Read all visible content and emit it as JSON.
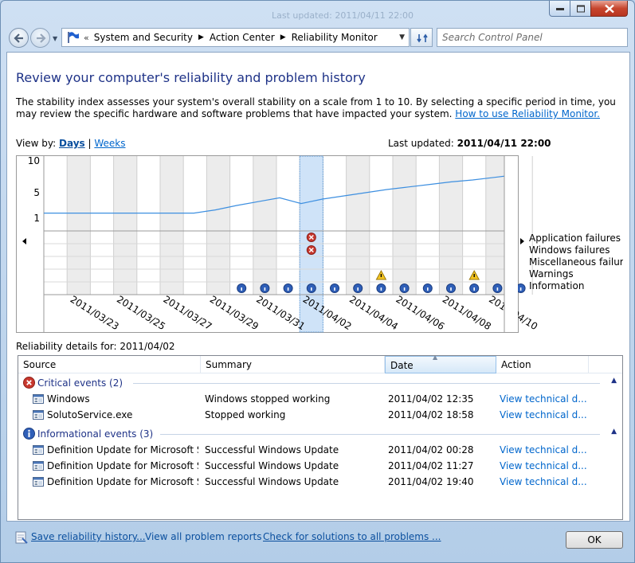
{
  "window": {
    "ghost_title": "Last updated: 2011/04/11 22:00"
  },
  "nav": {
    "address": [
      "System and Security",
      "Action Center",
      "Reliability Monitor"
    ],
    "search_placeholder": "Search Control Panel"
  },
  "main": {
    "title": "Review your computer's reliability and problem history",
    "desc": "The stability index assesses your system's overall stability on a scale from 1 to 10. By selecting a specific period in time, you may review the specific hardware and software problems that have impacted your system.",
    "desc_link": "How to use Reliability Monitor.",
    "viewby_label": "View by:",
    "viewby_days": "Days",
    "viewby_sep": "|",
    "viewby_weeks": "Weeks",
    "last_updated_label": "Last updated:",
    "last_updated_value": "2011/04/11 22:00"
  },
  "chart_data": {
    "type": "line",
    "yticks": [
      10,
      5,
      1
    ],
    "ylim": [
      0,
      10
    ],
    "columns": 21,
    "selected_column": 11,
    "date_labels": [
      "2011/03/23",
      "2011/03/25",
      "2011/03/27",
      "2011/03/29",
      "2011/03/31",
      "2011/04/02",
      "2011/04/04",
      "2011/04/06",
      "2011/04/08",
      "2011/04/10"
    ],
    "stability_index": [
      1.8,
      1.8,
      1.8,
      1.8,
      1.8,
      1.8,
      1.8,
      1.8,
      2.3,
      3.0,
      3.6,
      4.2,
      3.3,
      4.0,
      4.5,
      5.0,
      5.5,
      5.9,
      6.3,
      6.7,
      7.0,
      7.4,
      7.8
    ],
    "legend": [
      "Application failures",
      "Windows failures",
      "Miscellaneous failures",
      "Warnings",
      "Information"
    ],
    "events": {
      "application_failures": [
        11
      ],
      "windows_failures": [
        11
      ],
      "misc_failures": [],
      "warnings": [
        14,
        18
      ],
      "information": [
        8,
        9,
        10,
        11,
        12,
        13,
        14,
        15,
        16,
        17,
        18,
        19,
        20
      ]
    },
    "colors": {
      "line": "#3d8fe0",
      "shade": "#ececec",
      "selected": "#cfe3f8",
      "grid": "#cfcfcf"
    }
  },
  "details": {
    "label": "Reliability details for:",
    "date": "2011/04/02",
    "columns": [
      "Source",
      "Summary",
      "Date",
      "Action"
    ],
    "groups": [
      {
        "label": "Critical events (2)",
        "icon": "error-icon",
        "rows": [
          {
            "source": "Windows",
            "summary": "Windows stopped working",
            "date": "2011/04/02 12:35",
            "action": "View  technical d..."
          },
          {
            "source": "SolutoService.exe",
            "summary": "Stopped working",
            "date": "2011/04/02 18:58",
            "action": "View  technical d..."
          }
        ]
      },
      {
        "label": "Informational events (3)",
        "icon": "info-icon",
        "rows": [
          {
            "source": "Definition Update for Microsoft Se...",
            "summary": "Successful Windows Update",
            "date": "2011/04/02 00:28",
            "action": "View  technical d..."
          },
          {
            "source": "Definition Update for Microsoft Se...",
            "summary": "Successful Windows Update",
            "date": "2011/04/02 11:27",
            "action": "View  technical d..."
          },
          {
            "source": "Definition Update for Microsoft Se...",
            "summary": "Successful Windows Update",
            "date": "2011/04/02 19:40",
            "action": "View  technical d..."
          }
        ]
      }
    ]
  },
  "footer": {
    "save": "Save reliability history...",
    "view_all": "View all problem reports",
    "check": "Check for solutions to all problems ...",
    "ok": "OK"
  }
}
